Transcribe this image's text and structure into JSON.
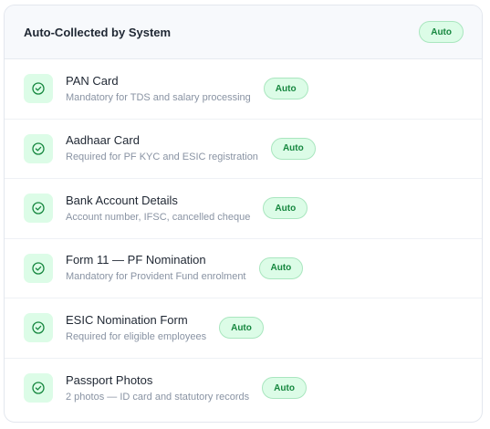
{
  "section": {
    "title": "Auto-Collected by System",
    "badge": "Auto"
  },
  "colors": {
    "accent_green": "#16873f",
    "badge_bg": "#dcfce7"
  },
  "documents": [
    {
      "title": "PAN Card",
      "description": "Mandatory for TDS and salary processing",
      "badge": "Auto",
      "icon": "check-circle-icon"
    },
    {
      "title": "Aadhaar Card",
      "description": "Required for PF KYC and ESIC registration",
      "badge": "Auto",
      "icon": "check-circle-icon"
    },
    {
      "title": "Bank Account Details",
      "description": "Account number, IFSC, cancelled cheque",
      "badge": "Auto",
      "icon": "check-circle-icon"
    },
    {
      "title": "Form 11 — PF Nomination",
      "description": "Mandatory for Provident Fund enrolment",
      "badge": "Auto",
      "icon": "check-circle-icon"
    },
    {
      "title": "ESIC Nomination Form",
      "description": "Required for eligible employees",
      "badge": "Auto",
      "icon": "check-circle-icon"
    },
    {
      "title": "Passport Photos",
      "description": "2 photos — ID card and statutory records",
      "badge": "Auto",
      "icon": "check-circle-icon"
    }
  ]
}
